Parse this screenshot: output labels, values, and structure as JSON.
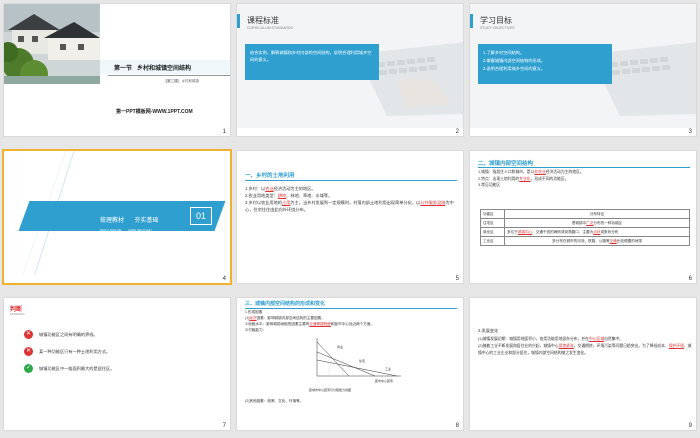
{
  "colors": {
    "accent": "#2f9fd0",
    "selection": "#f0b030",
    "red": "#d33333",
    "green": "#2aa84a"
  },
  "slides": [
    {
      "num": "1",
      "section": "第一节",
      "title": "乡村和城镇空间结构",
      "sub_badge": "[第二课]",
      "sub_tail": "乡村和城镇",
      "website": "第一PPT模板网-WWW.1PPT.COM"
    },
    {
      "num": "2",
      "heading": "课程标准",
      "heading_en": "CURRICULUM STANDARDS",
      "text": "结合实例，解释城镇和乡村内部的空间结构，说明合理利用城乡空间的意义。"
    },
    {
      "num": "3",
      "heading": "学习目标",
      "heading_en": "STUDY OBJECTIVES",
      "items": [
        "1.了解乡村空间结构。",
        "2.掌握城镇内部空间结构的形成。",
        "3.说明合理利用城乡空间的意义。"
      ]
    },
    {
      "num": "4",
      "left": "梳理教材",
      "left_py": "SHU LI JIAO CAI",
      "right": "夯实基础",
      "right_py": "HANG SHI JI CHU",
      "badge": "01"
    },
    {
      "num": "5",
      "heading": "一、乡村的土地利用",
      "lines": [
        [
          "1.乡村：以",
          {
            "r": "农业"
          },
          "经济活动为主的地区。"
        ],
        [
          "2.农业用地类型：",
          {
            "r": "耕地"
          },
          "、林地、草地、水域等。"
        ],
        [
          "3.乡村以农业用地的",
          {
            "r": "占用"
          },
          "为主。当乡村发展到一定规模时，村落内部土地利用出现简单分化，以",
          {
            "r": "公共服务设施"
          },
          "为中心，住宅往往由此向外环绕分布。"
        ]
      ]
    },
    {
      "num": "6",
      "heading": "二、城镇内部空间结构",
      "lines": [
        [
          "1.城镇：指居住人口和城市，是以",
          {
            "r": "非农业"
          },
          "经济活动为主的地区。"
        ],
        [
          "2.特点：出现土地利用的",
          {
            "r": "专业化"
          },
          "，形成不同的功能区。"
        ],
        [
          "3.常见功能区"
        ]
      ],
      "table_head": [
        "功能区",
        "",
        "分布特征"
      ],
      "table_rows": [
        [
          "住宅区",
          "",
          "是城镇中",
          {
            "r": "广泛"
          },
          "分布的一种功能区"
        ],
        [
          "商业区",
          "多位于",
          {
            "r": "城镇中心"
          },
          "、交通干线的两侧或街角路口，主要为",
          {
            "r": "点状"
          },
          "或条状分布"
        ],
        [
          "工业区",
          "多分布在城市的河流、铁路、公路等",
          {
            "r": "交通"
          },
          "比较便捷的地带",
          ""
        ]
      ]
    },
    {
      "num": "7",
      "heading": "判断",
      "heading_en": "PANDUAN",
      "items": [
        {
          "icon": "x",
          "text": "城镇功能区之间有明确的界线。"
        },
        {
          "icon": "x",
          "text": "某一种功能区只有一种土地利用方式。"
        },
        {
          "icon": "check",
          "text": "城镇功能区中一般面积最大的是居住区。"
        }
      ]
    },
    {
      "num": "8",
      "heading": "三、城镇内部空间结构的形成和变化",
      "lines": [
        [
          "1.形成因素"
        ],
        [
          "(1)",
          {
            "r": "经济"
          },
          "因素：影响城镇内部空间结构的主要因素。"
        ],
        [
          "①地租水平：影响城镇地租的因素主要有",
          {
            "r": "交通便捷程度"
          },
          "和距市中心远近两个方面。"
        ],
        [
          "②付租能力："
        ]
      ],
      "chart_caption": "距城市中心距离与付租能力线图",
      "chart_labels": [
        "商业",
        "住宅",
        "工业",
        "距市中心距离"
      ],
      "tail": "(2)其他因素：政策、文化、环境等。"
    },
    {
      "num": "9",
      "heading": "2.发展变化",
      "lines": [
        [
          "(1)城镇发展初期：城镇用地面积小，各类功能用地混杂分布，并在",
          {
            "r": "中心区域"
          },
          "自然集中。"
        ],
        [
          "(2)随着工业不断发展和居住业的兴起，城镇中心",
          {
            "r": "用地紧张"
          },
          "，交通拥挤，环境污染等问题日趋突出，为了降低成本、",
          {
            "r": "保护环境"
          },
          "，城镇中心的工业企业和部分居住，城镇内部空间结构随之发生变化。"
        ]
      ]
    }
  ]
}
